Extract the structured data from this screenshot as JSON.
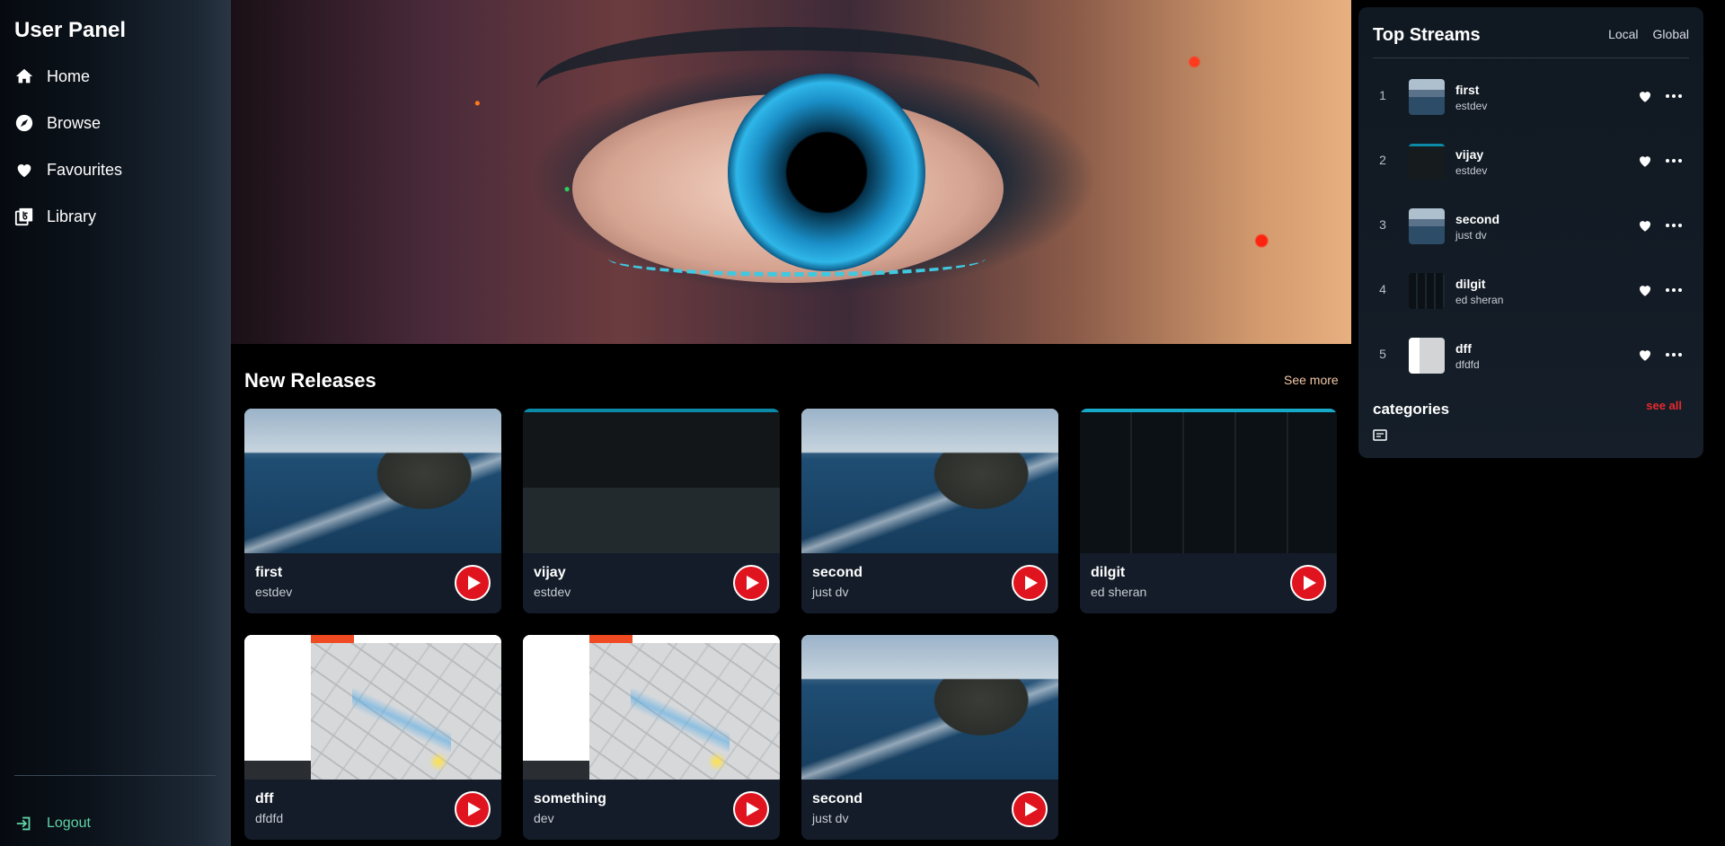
{
  "sidebar": {
    "title": "User Panel",
    "nav": [
      {
        "label": "Home",
        "icon": "home-icon"
      },
      {
        "label": "Browse",
        "icon": "compass-icon"
      },
      {
        "label": "Favourites",
        "icon": "heart-icon"
      },
      {
        "label": "Library",
        "icon": "library-icon"
      }
    ],
    "logout": "Logout"
  },
  "releases": {
    "title": "New Releases",
    "see_more": "See more",
    "cards": [
      {
        "name": "first",
        "artist": "estdev",
        "thumb": "island"
      },
      {
        "name": "vijay",
        "artist": "estdev",
        "thumb": "dark"
      },
      {
        "name": "second",
        "artist": "just dv",
        "thumb": "island"
      },
      {
        "name": "dilgit",
        "artist": "ed sheran",
        "thumb": "dash"
      },
      {
        "name": "dff",
        "artist": "dfdfd",
        "thumb": "map"
      },
      {
        "name": "something",
        "artist": "dev",
        "thumb": "map"
      },
      {
        "name": "second",
        "artist": "just dv",
        "thumb": "island"
      }
    ]
  },
  "top_streams": {
    "title": "Top Streams",
    "tabs": [
      "Local",
      "Global"
    ],
    "items": [
      {
        "rank": "1",
        "name": "first",
        "artist": "estdev",
        "thumb": "island"
      },
      {
        "rank": "2",
        "name": "vijay",
        "artist": "estdev",
        "thumb": "dark"
      },
      {
        "rank": "3",
        "name": "second",
        "artist": "just dv",
        "thumb": "island"
      },
      {
        "rank": "4",
        "name": "dilgit",
        "artist": "ed sheran",
        "thumb": "dash"
      },
      {
        "rank": "5",
        "name": "dff",
        "artist": "dfdfd",
        "thumb": "map"
      }
    ],
    "categories_title": "categories",
    "see_all": "see all"
  },
  "colors": {
    "accent_play": "#e0141f",
    "logout": "#5fd3a6",
    "see_all": "#e8292f",
    "see_more": "#f2c7a8"
  }
}
